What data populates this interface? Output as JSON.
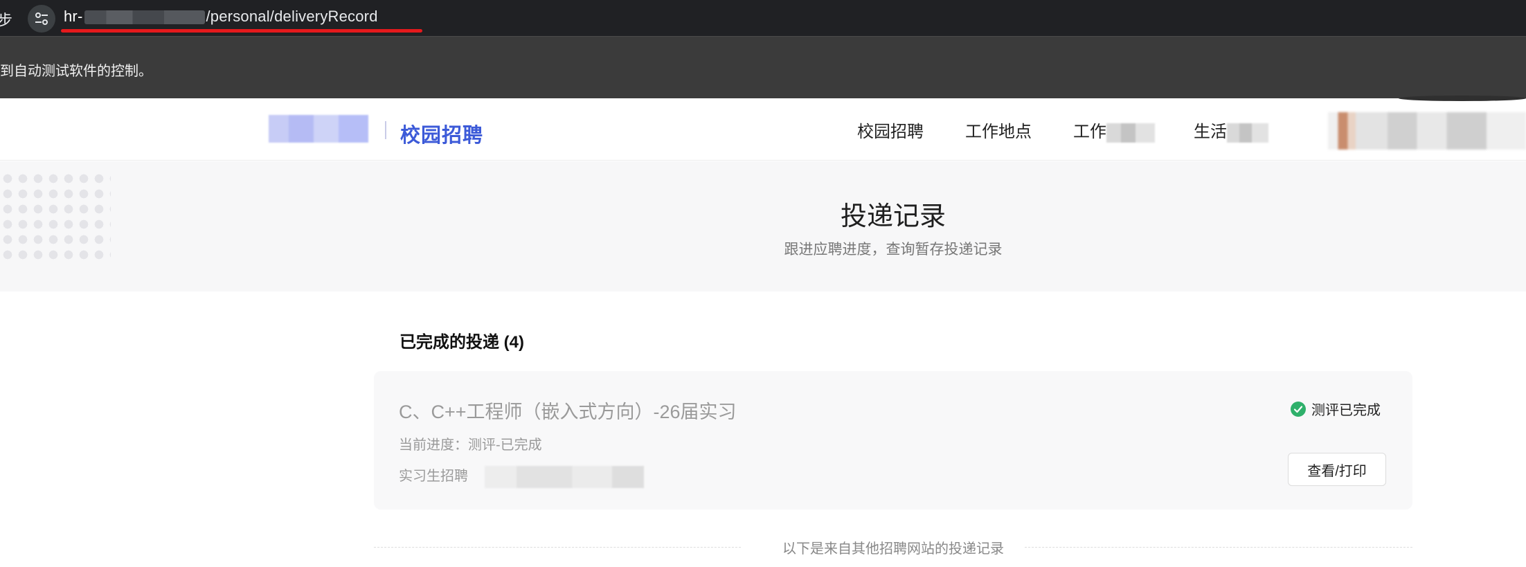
{
  "browser": {
    "left_glyph": "步",
    "url_host": "hr-",
    "url_path": "/personal/deliveryRecord",
    "infobar_text": "到自动测试软件的控制。"
  },
  "header": {
    "brand_title": "校园招聘",
    "nav": [
      {
        "label": "校园招聘"
      },
      {
        "label": "工作地点"
      },
      {
        "label": "工作"
      },
      {
        "label": "生活"
      }
    ]
  },
  "banner": {
    "title": "投递记录",
    "subtitle": "跟进应聘进度，查询暂存投递记录"
  },
  "completed": {
    "heading": "已完成的投递 (4)",
    "card": {
      "title": "C、C++工程师（嵌入式方向）-26届实习",
      "progress": "当前进度：测评-已完成",
      "type": "实习生招聘",
      "status": "测评已完成",
      "action_label": "查看/打印"
    }
  },
  "other_divider": "以下是来自其他招聘网站的投递记录",
  "colors": {
    "brand_blue": "#3c5ad8",
    "status_green": "#2fb06b",
    "url_underline": "#e5191c"
  }
}
